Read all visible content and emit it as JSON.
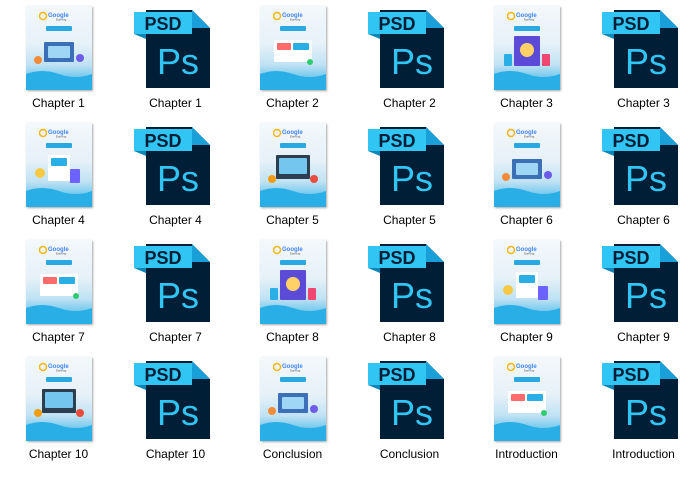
{
  "window": {
    "title": ""
  },
  "items": [
    {
      "label": "Chapter 1",
      "type": "cover"
    },
    {
      "label": "Chapter 1",
      "type": "psd"
    },
    {
      "label": "Chapter 2",
      "type": "cover"
    },
    {
      "label": "Chapter 2",
      "type": "psd"
    },
    {
      "label": "Chapter 3",
      "type": "cover"
    },
    {
      "label": "Chapter 3",
      "type": "psd"
    },
    {
      "label": "Chapter 4",
      "type": "cover"
    },
    {
      "label": "Chapter 4",
      "type": "psd"
    },
    {
      "label": "Chapter 5",
      "type": "cover"
    },
    {
      "label": "Chapter 5",
      "type": "psd"
    },
    {
      "label": "Chapter 6",
      "type": "cover"
    },
    {
      "label": "Chapter 6",
      "type": "psd"
    },
    {
      "label": "Chapter 7",
      "type": "cover"
    },
    {
      "label": "Chapter 7",
      "type": "psd"
    },
    {
      "label": "Chapter 8",
      "type": "cover"
    },
    {
      "label": "Chapter 8",
      "type": "psd"
    },
    {
      "label": "Chapter 9",
      "type": "cover"
    },
    {
      "label": "Chapter 9",
      "type": "psd"
    },
    {
      "label": "Chapter 10",
      "type": "cover"
    },
    {
      "label": "Chapter 10",
      "type": "psd"
    },
    {
      "label": "Conclusion",
      "type": "cover"
    },
    {
      "label": "Conclusion",
      "type": "psd"
    },
    {
      "label": "Introduction",
      "type": "cover"
    },
    {
      "label": "Introduction",
      "type": "psd"
    }
  ],
  "psd_icon": {
    "tag": "PSD",
    "glyph": "Ps",
    "tag_color": "#31c5f4",
    "body_color": "#001e36",
    "glyph_color": "#31c5f4",
    "fold_color": "#1aa0d8"
  },
  "cover_colors": {
    "accent": "#29aee6",
    "logo_word": "Google",
    "logo_sub": "Earning"
  }
}
